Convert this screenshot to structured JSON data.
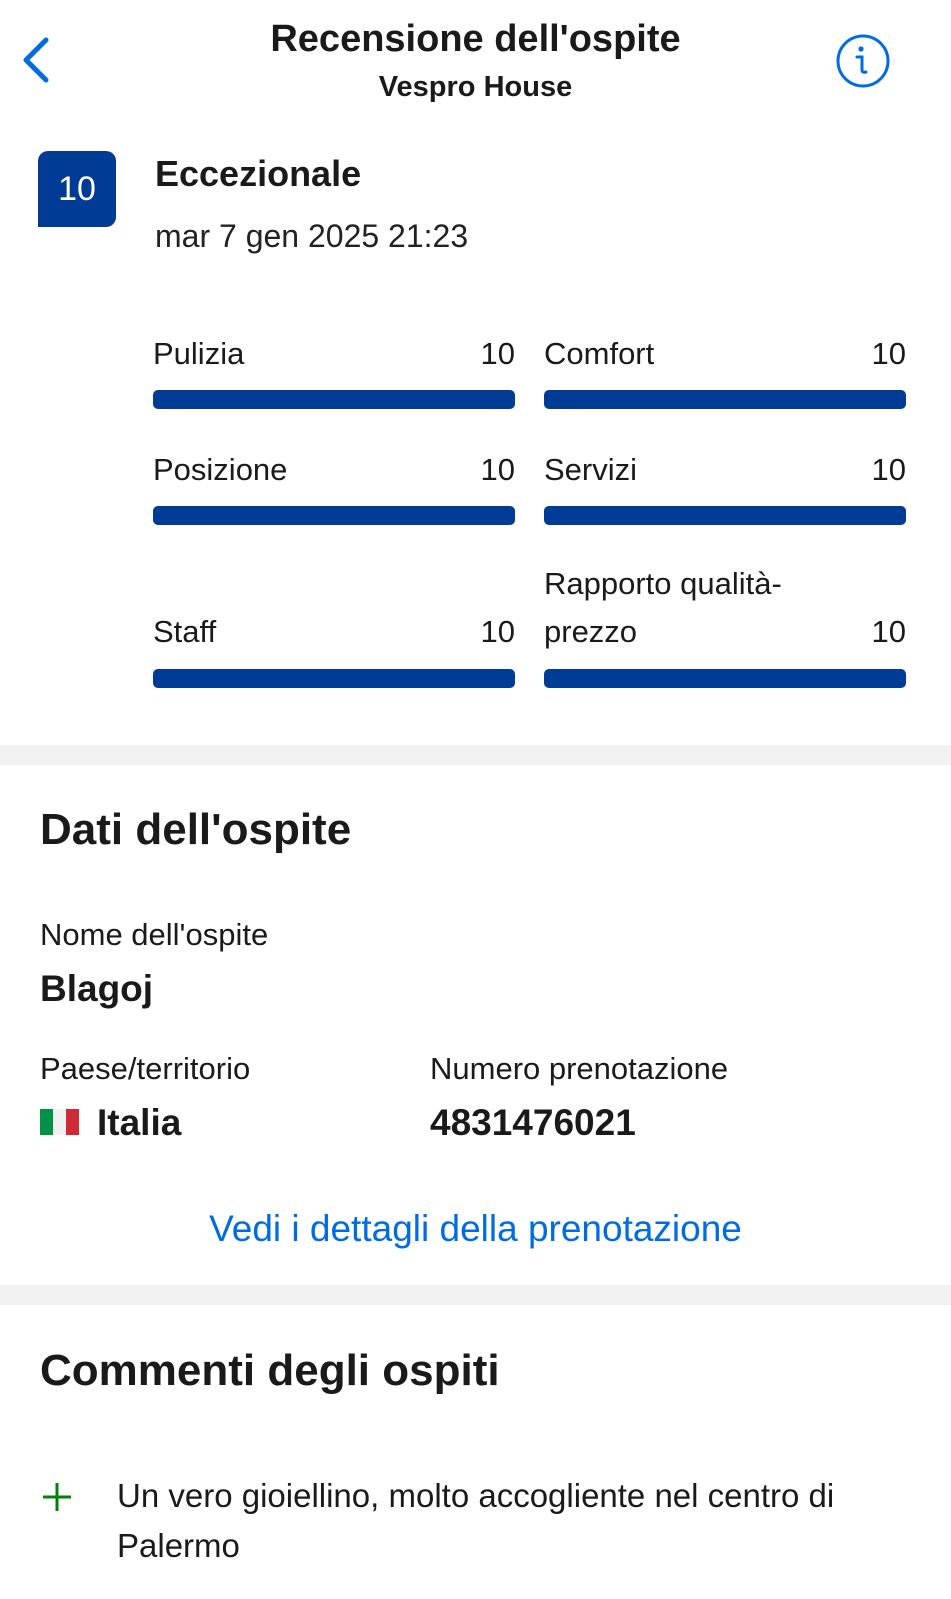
{
  "header": {
    "title": "Recensione dell'ospite",
    "subtitle": "Vespro House",
    "back_icon": "chevron-left-icon",
    "info_icon": "info-icon"
  },
  "colors": {
    "brand": "#003b95",
    "link": "#006ce4",
    "positive": "#008009"
  },
  "review": {
    "score": "10",
    "label": "Eccezionale",
    "date": "mar 7 gen 2025 21:23"
  },
  "categories": [
    {
      "name": "Pulizia",
      "value": "10",
      "fraction": 1.0
    },
    {
      "name": "Comfort",
      "value": "10",
      "fraction": 1.0
    },
    {
      "name": "Posizione",
      "value": "10",
      "fraction": 1.0
    },
    {
      "name": "Servizi",
      "value": "10",
      "fraction": 1.0
    },
    {
      "name": "Staff",
      "value": "10",
      "fraction": 1.0
    },
    {
      "name": "Rapporto qualità-prezzo",
      "value": "10",
      "fraction": 1.0
    }
  ],
  "guest": {
    "heading": "Dati dell'ospite",
    "name_label": "Nome dell'ospite",
    "name": "Blagoj",
    "country_label": "Paese/territorio",
    "country": "Italia",
    "country_flag": "italy-flag",
    "booking_label": "Numero prenotazione",
    "booking_number": "4831476021",
    "details_link": "Vedi i dettagli della prenotazione"
  },
  "comments": {
    "heading": "Commenti degli ospiti",
    "positive_icon": "plus-icon",
    "positive": "Un vero gioiellino, molto accogliente nel centro di Palermo"
  }
}
